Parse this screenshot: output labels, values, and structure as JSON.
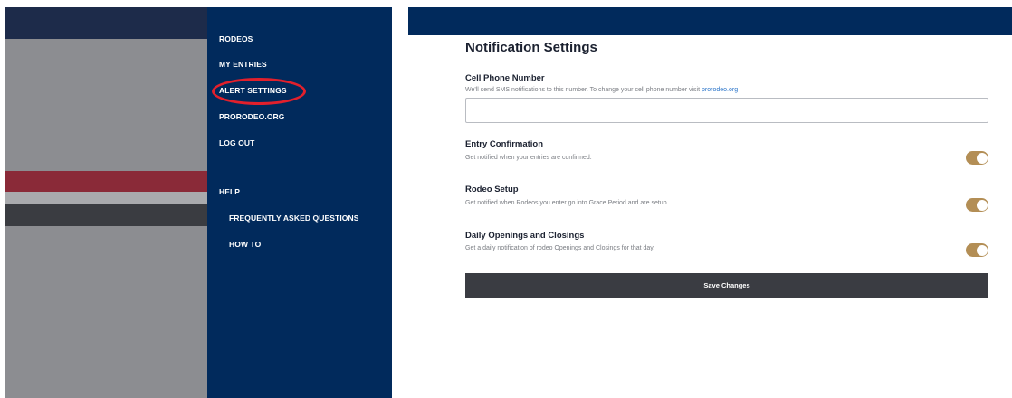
{
  "menu": {
    "items": [
      {
        "label": "RODEOS"
      },
      {
        "label": "MY ENTRIES"
      },
      {
        "label": "ALERT SETTINGS"
      },
      {
        "label": "PRORODEO.ORG"
      },
      {
        "label": "LOG OUT"
      },
      {
        "label": "HELP"
      },
      {
        "label": "FREQUENTLY ASKED QUESTIONS"
      },
      {
        "label": "HOW TO"
      }
    ],
    "highlighted_item": "ALERT SETTINGS",
    "highlight_color": "#e2202c"
  },
  "settings": {
    "title": "Notification Settings",
    "phone": {
      "label": "Cell Phone Number",
      "description": "We'll send SMS notifications to this number. To change your cell phone number visit ",
      "link_text": "prorodeo.org",
      "value": ""
    },
    "toggles": [
      {
        "label": "Entry Confirmation",
        "description": "Get notified when your entries are confirmed.",
        "enabled": true
      },
      {
        "label": "Rodeo Setup",
        "description": "Get notified when Rodeos you enter go into Grace Period and are setup.",
        "enabled": true
      },
      {
        "label": "Daily Openings and Closings",
        "description": "Get a daily notification of rodeo Openings and Closings for that day.",
        "enabled": true
      }
    ],
    "save_label": "Save Changes"
  },
  "colors": {
    "navy": "#012a5c",
    "toggle_on": "#b38e55",
    "button": "#3a3c42",
    "link": "#2a74c9"
  }
}
